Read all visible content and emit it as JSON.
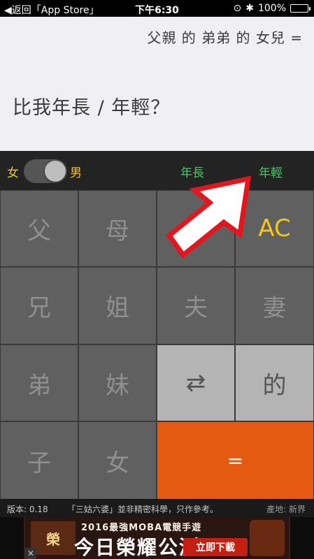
{
  "status_bar": {
    "back": "◀返回「App Store」",
    "time": "下午6:30",
    "battery": "100%"
  },
  "display": {
    "expression": "父親 的 弟弟 的 女兒 =",
    "question": "比我年長 / 年輕？"
  },
  "options": {
    "female_label": "女",
    "male_label": "男",
    "gender_selected": "男",
    "older_label": "年長",
    "younger_label": "年輕"
  },
  "keypad": {
    "father": "父",
    "mother": "母",
    "all_clear": "AC",
    "elder_brother": "兄",
    "elder_sister": "姐",
    "husband": "夫",
    "wife": "妻",
    "younger_brother": "弟",
    "younger_sister": "妹",
    "swap": "⇄",
    "of": "的",
    "son": "子",
    "daughter": "女",
    "equals": "="
  },
  "footer": {
    "version": "版本: 0.18",
    "note": "「三姑六婆」並非精密科學，只作參考。",
    "origin": "產地: 新界"
  },
  "ad": {
    "headline": "2016最強MOBA電競手遊",
    "big_text": "今日榮耀公測",
    "download": "立即下載",
    "close": "✕"
  },
  "colors": {
    "accent_yellow": "#f7c516",
    "accent_green": "#3ecf5a",
    "equals_orange": "#e35a10",
    "arrow_red": "#e8141b"
  }
}
